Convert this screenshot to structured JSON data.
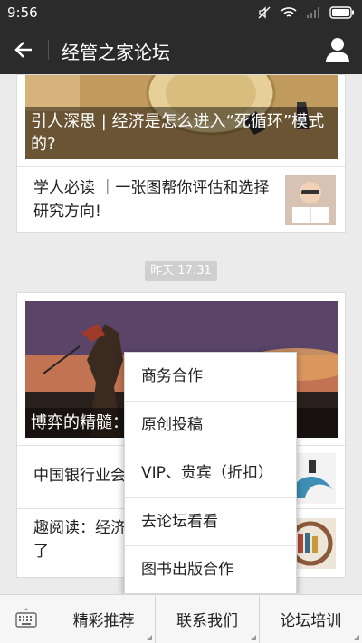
{
  "status_bar": {
    "time": "9:56"
  },
  "header": {
    "title": "经管之家论坛"
  },
  "feed": {
    "card1": {
      "hero_caption": "引人深思 | 经济是怎么进入“死循环”模式的?",
      "row_text": "学人必读 ｜一张图帮你评估和选择研究方向!"
    },
    "time_badge": "昨天 17:31",
    "card2": {
      "hero_caption": "博弈的精髓：",
      "row1_text": "中国银行业会",
      "row2_text": "趣阅读：经济",
      "row2_text_line2": "了"
    }
  },
  "popup_menu": {
    "items": [
      "商务合作",
      "原创投稿",
      "VIP、贵宾（折扣）",
      "去论坛看看",
      "图书出版合作"
    ]
  },
  "bottom_bar": {
    "menus": [
      "精彩推荐",
      "联系我们",
      "论坛培训"
    ]
  },
  "colors": {
    "header_bg": "#2b2b2b",
    "page_bg": "#ebebeb"
  }
}
